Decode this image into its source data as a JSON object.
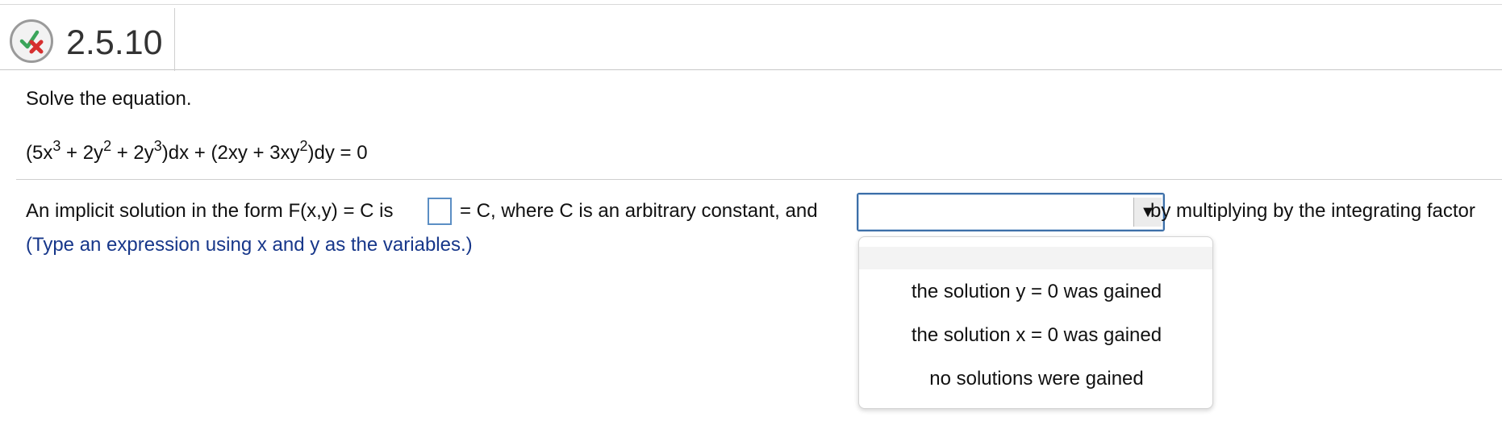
{
  "header": {
    "problem_id": "2.5.10",
    "status_icon": "partial-credit-check-x-icon",
    "icon_colors": {
      "check": "#3aa55a",
      "cross": "#d62f2f"
    }
  },
  "problem": {
    "instruction": "Solve the equation.",
    "equation": {
      "p1": "(5x",
      "e1": "3",
      "p2": " + 2y",
      "e2": "2",
      "p3": " + 2y",
      "e3": "3",
      "p4": ")dx + (2xy + 3xy",
      "e4": "2",
      "p5": ")dy = 0"
    }
  },
  "answer": {
    "text_before_box": "An implicit solution in the form F(x,y) = C is",
    "box_value": "",
    "text_after_box": "= C, where C is an arbitrary constant, and",
    "select_value": "",
    "select_arrow": "▼",
    "text_after_select": "by multiplying by the integrating factor",
    "hint": "(Type an expression using x and y as the variables.)"
  },
  "dropdown": {
    "blank_option": "",
    "options": [
      "the solution y = 0 was gained",
      "the solution x = 0 was gained",
      "no solutions were gained"
    ]
  }
}
